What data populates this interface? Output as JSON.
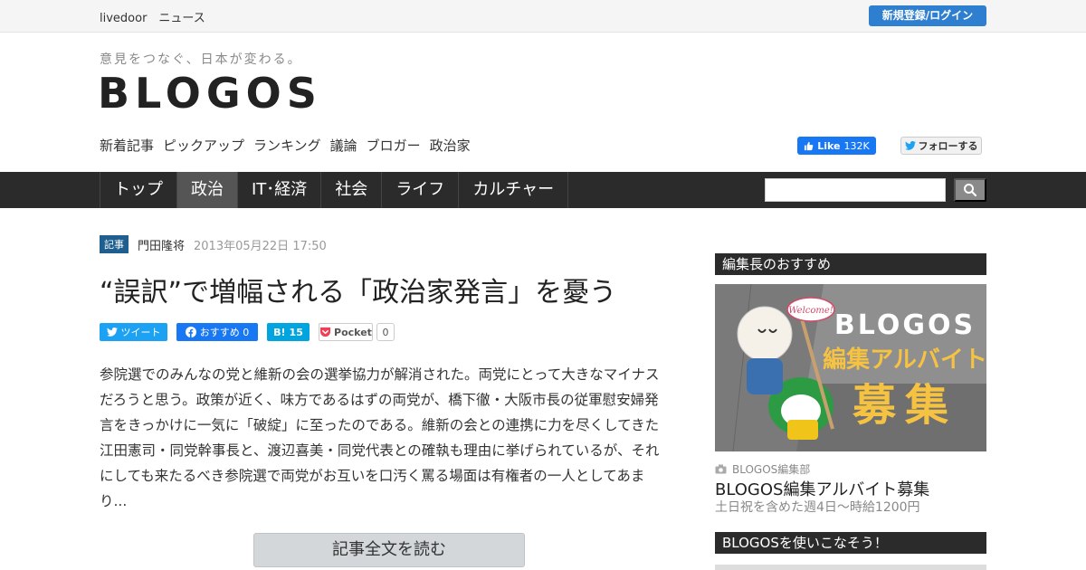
{
  "topbar": {
    "brand": "livedoor　ニュース",
    "login_label": "新規登録/ログイン"
  },
  "header": {
    "tagline": "意見をつなぐ、日本が変わる。",
    "logo": "BLOGOS",
    "subnav": [
      "新着記事",
      "ピックアップ",
      "ランキング",
      "議論",
      "ブロガー",
      "政治家"
    ],
    "fb_like_label": "Like",
    "fb_like_count": "132K",
    "tw_follow_label": "フォローする"
  },
  "mainnav": {
    "items": [
      "トップ",
      "政治",
      "IT･経済",
      "社会",
      "ライフ",
      "カルチャー"
    ],
    "active_index": 1,
    "search_placeholder": ""
  },
  "article": {
    "tag": "記事",
    "author": "門田隆将",
    "date": "2013年05月22日 17:50",
    "title": "“誤訳”で増幅される「政治家発言」を憂う",
    "share": {
      "tweet_label": "ツイート",
      "fb_label": "おすすめ 0",
      "hatena_label": "B!",
      "hatena_count": "15",
      "pocket_label": "Pocket",
      "pocket_count": "0"
    },
    "lines": [
      "参院選でのみんなの党と維新の会の選挙協力が解消された。両党にとって大きなマイナス",
      "だろうと思う。政策が近く、味方であるはずの両党が、橋下徹・大阪市長の従軍慰安婦発",
      "言をきっかけに一気に「破綻」に至ったのである。維新の会との連携に力を尽くしてきた",
      "江田憲司・同党幹事長と、渡辺喜美・同党代表との確執も理由に挙げられているが、それ",
      "にしても来たるべき参院選で両党がお互いを口汚く罵る場面は有権者の一人としてあま",
      "り..."
    ],
    "read_more_label": "記事全文を読む"
  },
  "sidebar": {
    "recommend_head": "編集長のおすすめ",
    "image": {
      "logo": "BLOGOS",
      "line1": "編集アルバイト",
      "line2": "募集",
      "welcome": "Welcome!"
    },
    "source": "BLOGOS編集部",
    "item_title": "BLOGOS編集アルバイト募集",
    "item_desc": "土日祝を含めた週4日〜時給1200円",
    "guide_head": "BLOGOSを使いこなそう！"
  },
  "colors": {
    "nav_bg": "#2b2b2b",
    "nav_active": "#555555",
    "login_blue": "#2f7fd0",
    "tag_blue": "#1f5f8f"
  }
}
